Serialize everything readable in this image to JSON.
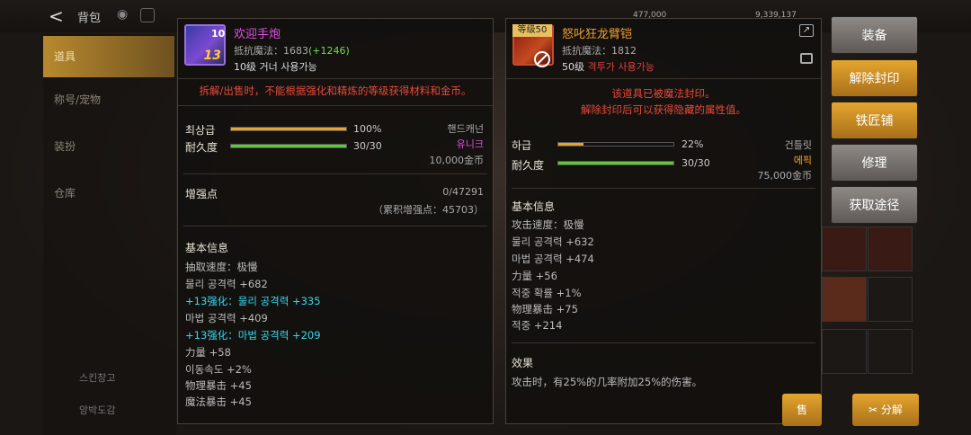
{
  "top": {
    "back": "<",
    "title": "背包",
    "currency1": "477,000",
    "currency2": "9,339,137"
  },
  "sidebar": {
    "tabs": [
      "道具",
      "称号/宠物",
      "装扮",
      "仓库"
    ],
    "bottom": [
      "스킨창고",
      "앙박도감"
    ]
  },
  "item1": {
    "badge_level": "10",
    "enhance_display": "13",
    "name": "欢迎手炮",
    "resist_label": "抵抗魔法：1683",
    "resist_bonus": "(+1246)",
    "req": "10级 거너 사용가능",
    "warning": "拆解/出售时，不能根据强化和精炼的等级获得材料和金币。",
    "grade_label": "최상급",
    "grade_pct": "100%",
    "grade_fill": 1.0,
    "dur_label": "耐久度",
    "dur_value": "30/30",
    "dur_fill": 1.0,
    "type": "핸드캐넌",
    "rarity": "유니크",
    "price": "10,000金币",
    "enhance_label": "增强点",
    "enhance_value": "0/47291",
    "enhance_acc": "（累积增强点：45703）",
    "basic_hd": "基本信息",
    "stats": [
      "抽取速度：极慢",
      "물리 공격력 +682",
      "+13强化：물리 공격력 +335",
      "마법 공격력 +409",
      "+13强化：마법 공격력 +209",
      "力量 +58",
      "이동속도 +2%",
      "物理暴击 +45",
      "魔法暴击 +45"
    ]
  },
  "item2": {
    "badge": "等级50",
    "name": "怒叱狂龙臂铠",
    "resist": "抵抗魔法：1812",
    "req_lv": "50级",
    "req_cls": "격투가 사용가능",
    "warn1": "该道具已被魔法封印。",
    "warn2": "解除封印后可以获得隐藏的属性值。",
    "grade_label": "하급",
    "grade_pct": "22%",
    "grade_fill": 0.22,
    "dur_label": "耐久度",
    "dur_value": "30/30",
    "dur_fill": 1.0,
    "type": "건틀릿",
    "rarity": "에픽",
    "price": "75,000金币",
    "basic_hd": "基本信息",
    "stats": [
      "攻击速度：极慢",
      "물리 공격력 +632",
      "마법 공격력 +474",
      "力量 +56",
      "적중 확률 +1%",
      "物理暴击 +75",
      "적중 +214"
    ],
    "effect_hd": "效果",
    "effect": "攻击时，有25%的几率附加25%的伤害。"
  },
  "buttons": [
    "装备",
    "解除封印",
    "铁匠铺",
    "修理",
    "获取途径"
  ],
  "bottom_btns": {
    "sell": "售",
    "disassemble": "分解"
  },
  "slot_label": "等级50",
  "colors": {
    "gold": "#e5a52e",
    "gray": "#8f8a86",
    "epic": "#f0a030",
    "unique": "#e050e0"
  }
}
